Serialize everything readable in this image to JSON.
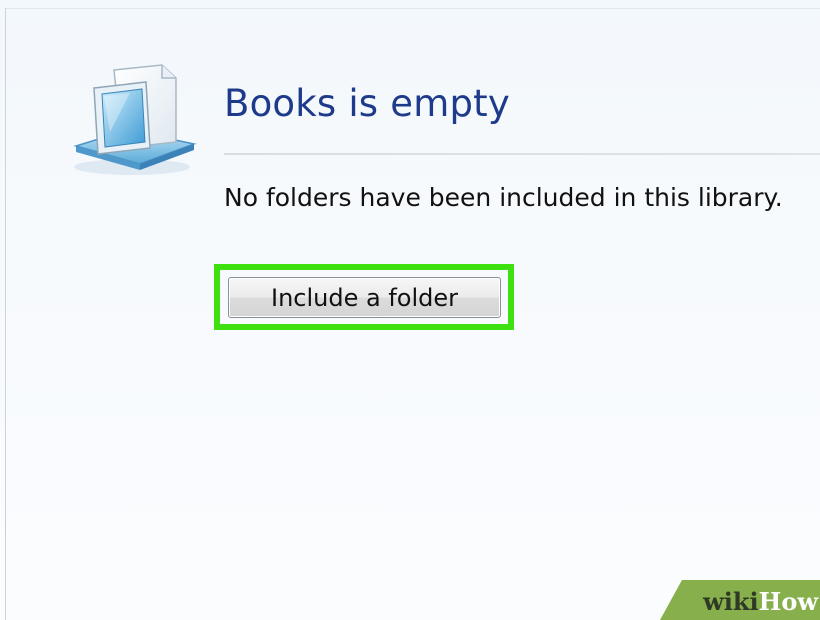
{
  "library": {
    "title": "Books is empty",
    "message": "No folders have been included in this library.",
    "include_button_label": "Include a folder",
    "icon": "library-icon"
  },
  "highlight": {
    "color": "#3ee00f",
    "target": "include-a-folder-button"
  },
  "watermark": {
    "part1": "wiki",
    "part2": "How",
    "color": "#87b04d"
  },
  "colors": {
    "title": "#1e3a8a",
    "text": "#111111"
  }
}
